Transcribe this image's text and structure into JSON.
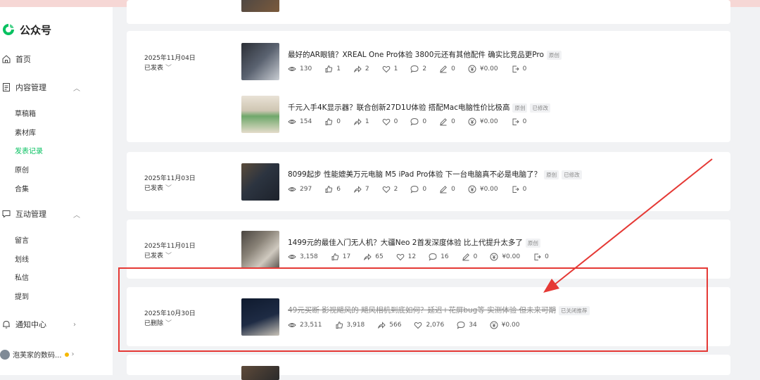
{
  "app": {
    "name": "公众号"
  },
  "sidebar": {
    "home": "首页",
    "content_mgmt": {
      "label": "内容管理",
      "items": [
        "草稿箱",
        "素材库",
        "发表记录",
        "原创",
        "合集"
      ]
    },
    "interaction_mgmt": {
      "label": "互动管理",
      "items": [
        "留言",
        "划线",
        "私信",
        "提到"
      ]
    },
    "notifications": "通知中心",
    "account_name": "泡芙家的数码..."
  },
  "colors": {
    "accent": "#07c160",
    "highlight": "#e53935"
  },
  "posts": [
    {
      "date": "2025年11月04日",
      "status": "已发表",
      "articles": [
        {
          "title": "最好的AR眼镜？XREAL One Pro体验 3800元还有其他配件 确实比竞品更Pro",
          "tags": [
            "原创"
          ],
          "stats": {
            "views": "130",
            "likes": "1",
            "shares": "2",
            "wows": "1",
            "comments": "2",
            "notes": "0",
            "earnings": "¥0.00",
            "subscribes": "0"
          }
        },
        {
          "title": "千元入手4K显示器？联合创新27D1U体验 搭配Mac电脑性价比极高",
          "tags": [
            "原创",
            "已修改"
          ],
          "stats": {
            "views": "154",
            "likes": "0",
            "shares": "1",
            "wows": "0",
            "comments": "0",
            "notes": "0",
            "earnings": "¥0.00",
            "subscribes": "0"
          }
        }
      ]
    },
    {
      "date": "2025年11月03日",
      "status": "已发表",
      "articles": [
        {
          "title": "8099起步 性能媲美万元电脑 M5 iPad Pro体验 下一台电脑真不必是电脑了？",
          "tags": [
            "原创",
            "已修改"
          ],
          "stats": {
            "views": "297",
            "likes": "6",
            "shares": "7",
            "wows": "2",
            "comments": "0",
            "notes": "0",
            "earnings": "¥0.00",
            "subscribes": "0"
          }
        }
      ]
    },
    {
      "date": "2025年11月01日",
      "status": "已发表",
      "articles": [
        {
          "title": "1499元的最佳入门无人机？大疆Neo 2首发深度体验 比上代提升太多了",
          "tags": [
            "原创"
          ],
          "stats": {
            "views": "3,158",
            "likes": "17",
            "shares": "65",
            "wows": "12",
            "comments": "16",
            "notes": "0",
            "earnings": "¥0.00",
            "subscribes": "0"
          }
        }
      ]
    },
    {
      "date": "2025年10月30日",
      "status": "已删除",
      "articles": [
        {
          "title": "49元买断 影视飓风的 飓风相机到底如何？延迟+花屏bug等 实测体验 但未来可期",
          "tags": [
            "已关闭推荐"
          ],
          "stats": {
            "views": "23,511",
            "likes": "3,918",
            "shares": "566",
            "wows": "2,076",
            "comments": "34",
            "earnings": "¥0.00"
          }
        }
      ]
    }
  ]
}
